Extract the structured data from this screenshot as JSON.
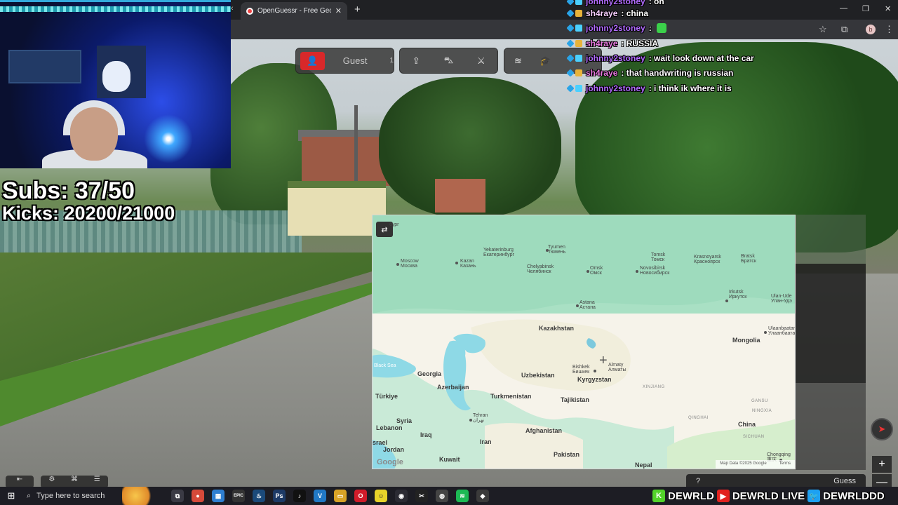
{
  "browser": {
    "tab_title": "OpenGuessr - Free GeoGuessr Alternative",
    "new_tab": "+",
    "close": "✕",
    "win_min": "—",
    "win_max": "❐",
    "win_close": "✕",
    "profile_initial": "b"
  },
  "game": {
    "player_name": "Guest",
    "player_count": "1",
    "guess_left": "?",
    "guess_label": "Guess",
    "zoom_in": "+",
    "zoom_out": "—"
  },
  "overlay": {
    "subs": "Subs: 37/50",
    "kicks": "Kicks: 20200/21000"
  },
  "chat": [
    {
      "user": "johnny2stoney",
      "user_color": "#b26cff",
      "msg": ": oh"
    },
    {
      "user": "sh4raye",
      "user_color": "#f7d0ff",
      "msg": ": china"
    },
    {
      "user": "johnny2stoney",
      "user_color": "#b26cff",
      "msg": ":"
    },
    {
      "user": "sh4raye",
      "user_color": "#e87adf",
      "msg": ": RUSSIA"
    },
    {
      "user": "johnny2stoney",
      "user_color": "#b26cff",
      "msg": ": wait look down at the car"
    },
    {
      "user": "sh4raye",
      "user_color": "#e87adf",
      "msg": ": that handwriting is russian"
    },
    {
      "user": "johnny2stoney",
      "user_color": "#b26cff",
      "msg": ": i think ik where it is"
    }
  ],
  "map": {
    "countries": [
      {
        "name": "Kazakhstan"
      },
      {
        "name": "Mongolia"
      },
      {
        "name": "Uzbekistan"
      },
      {
        "name": "Kyrgyzstan"
      },
      {
        "name": "Tajikistan"
      },
      {
        "name": "Turkmenistan"
      },
      {
        "name": "Georgia"
      },
      {
        "name": "Azerbaijan"
      },
      {
        "name": "Türkiye"
      },
      {
        "name": "Syria"
      },
      {
        "name": "Lebanon"
      },
      {
        "name": "Iraq"
      },
      {
        "name": "Iran"
      },
      {
        "name": "Afghanistan"
      },
      {
        "name": "Pakistan"
      },
      {
        "name": "Jordan"
      },
      {
        "name": "Kuwait"
      },
      {
        "name": "China"
      },
      {
        "name": "Nepal"
      },
      {
        "name": "srael"
      }
    ],
    "cities": [
      {
        "name": "Moscow\nМосква"
      },
      {
        "name": "Kazan\nКазань"
      },
      {
        "name": "Yekaterinburg\nЕкатеринбург"
      },
      {
        "name": "Tyumen\nТюмень"
      },
      {
        "name": "Chelyabinsk\nЧелябинск"
      },
      {
        "name": "Omsk\nОмск"
      },
      {
        "name": "Novosibirsk\nНовосибирск"
      },
      {
        "name": "Tomsk\nТомск"
      },
      {
        "name": "Krasnoyarsk\nКрасноярск"
      },
      {
        "name": "Bratsk\nБратск"
      },
      {
        "name": "Irkutsk\nИркутск"
      },
      {
        "name": "Ulan-Ude\nУлан-Удэ"
      },
      {
        "name": "Ulaanbaatar\nУлаанбаатар"
      },
      {
        "name": "Astana\nАстана"
      },
      {
        "name": "Almaty\nАлматы"
      },
      {
        "name": "Bishkek\nБишкек"
      },
      {
        "name": "Tehran\nتهران"
      },
      {
        "name": "Chongqing\n重庆"
      },
      {
        "name": "бург"
      }
    ],
    "regions": [
      {
        "name": "XINJIANG"
      },
      {
        "name": "QINGHAI"
      },
      {
        "name": "GANSU"
      },
      {
        "name": "NINGXIA"
      },
      {
        "name": "SICHUAN"
      },
      {
        "name": "Black Sea"
      }
    ],
    "google_logo": "Google",
    "attribution": "Map Data ©2025 Google",
    "terms": "Terms"
  },
  "taskbar": {
    "search_placeholder": "Type here to search",
    "icons": [
      {
        "name": "taskview",
        "label": "⧉",
        "color": "#3a3a44"
      },
      {
        "name": "chrome",
        "label": "●",
        "color": "#d64a3a"
      },
      {
        "name": "store",
        "label": "▦",
        "color": "#2f7fd1"
      },
      {
        "name": "epic",
        "label": "EPIC",
        "color": "#333"
      },
      {
        "name": "steam",
        "label": "♨",
        "color": "#1b4a7a"
      },
      {
        "name": "photoshop",
        "label": "Ps",
        "color": "#1d3a66"
      },
      {
        "name": "tiktok",
        "label": "♪",
        "color": "#111"
      },
      {
        "name": "vscode",
        "label": "V",
        "color": "#2178c4"
      },
      {
        "name": "explorer",
        "label": "▭",
        "color": "#d8a326"
      },
      {
        "name": "opera",
        "label": "O",
        "color": "#d01c2a"
      },
      {
        "name": "snapchat",
        "label": "☺",
        "color": "#e8d32a"
      },
      {
        "name": "obs",
        "label": "◉",
        "color": "#2b2b33"
      },
      {
        "name": "capcut",
        "label": "✂",
        "color": "#222"
      },
      {
        "name": "minecraft",
        "label": "◍",
        "color": "#444"
      },
      {
        "name": "spotify",
        "label": "≋",
        "color": "#1db954"
      },
      {
        "name": "app",
        "label": "◆",
        "color": "#3a3a3a"
      }
    ],
    "socials": [
      {
        "icon": "K",
        "color": "#53d32a",
        "name": "DEWRLD"
      },
      {
        "icon": "▶",
        "color": "#e2221f",
        "name": "DEWRLD LIVE"
      },
      {
        "icon": "🐦",
        "color": "#1da1f2",
        "name": "DEWRLDDD"
      }
    ]
  }
}
